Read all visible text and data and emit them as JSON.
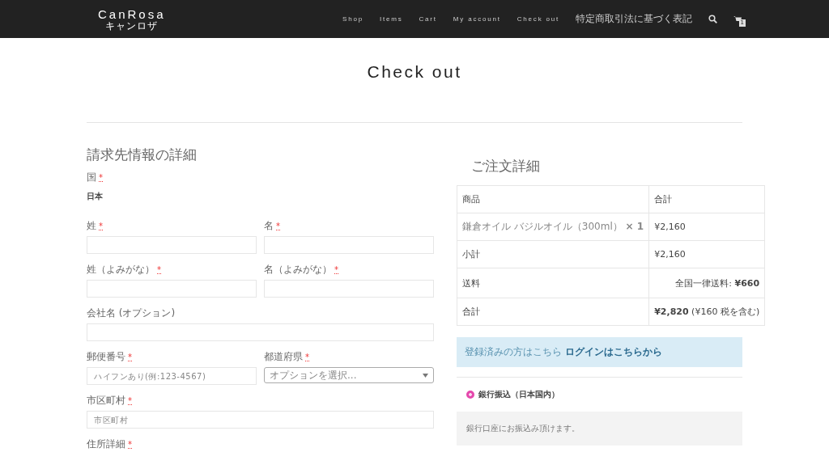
{
  "header": {
    "logo": "CanRosa",
    "logo_sub": "キャンロザ",
    "nav": [
      "Shop",
      "Items",
      "Cart",
      "My account",
      "Check out",
      "特定商取引法に基づく表記"
    ],
    "cart_count": "1"
  },
  "page_title": "Check out",
  "billing": {
    "heading": "請求先情報の詳細",
    "required_mark": "*",
    "rows": [
      [
        {
          "kind": "static",
          "label": "国",
          "required": true,
          "value": "日本"
        }
      ],
      [
        {
          "kind": "text",
          "label": "姓",
          "required": true
        },
        {
          "kind": "text",
          "label": "名",
          "required": true
        }
      ],
      [
        {
          "kind": "text",
          "label": "姓（よみがな）",
          "required": true
        },
        {
          "kind": "text",
          "label": "名（よみがな）",
          "required": true
        }
      ],
      [
        {
          "kind": "text",
          "label": "会社名 (オプション)",
          "required": false
        }
      ],
      [
        {
          "kind": "text",
          "label": "郵便番号",
          "required": true,
          "placeholder": "ハイフンあり(例:123-4567)"
        },
        {
          "kind": "select",
          "label": "都道府県",
          "required": true,
          "placeholder": "オプションを選択..."
        }
      ],
      [
        {
          "kind": "text",
          "label": "市区町村",
          "required": true,
          "placeholder": "市区町村"
        }
      ],
      [
        {
          "kind": "cut",
          "label": "住所詳細",
          "required": true
        }
      ]
    ]
  },
  "order": {
    "heading": "ご注文詳細",
    "columns": [
      "商品",
      "合計"
    ],
    "rows": [
      {
        "kind": "item",
        "label": "鎌倉オイル バジルオイル（300ml） **× 1**",
        "value": "¥2,160"
      },
      {
        "kind": "subtotal",
        "label": "小計",
        "value": "¥2,160"
      },
      {
        "kind": "shipping",
        "label": "送料",
        "value": "全国一律送料: **¥660**"
      },
      {
        "kind": "total",
        "label": "合計",
        "value": "**¥2,820** (¥160 税を含む)"
      }
    ]
  },
  "login_notice": {
    "text": "登録済みの方はこちら",
    "link": "ログインはこちらから"
  },
  "payment": {
    "methods": [
      {
        "label": "銀行振込（日本国内）",
        "selected": true
      }
    ],
    "description": "銀行口座にお振込み頂けます。"
  }
}
